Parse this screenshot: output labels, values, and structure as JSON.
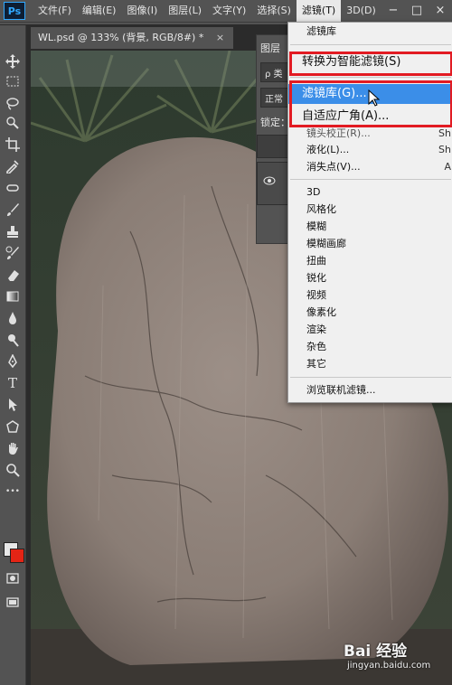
{
  "app": {
    "logo": "Ps",
    "menus": [
      "文件(F)",
      "编辑(E)",
      "图像(I)",
      "图层(L)",
      "文字(Y)",
      "选择(S)",
      "滤镜(T)",
      "3D(D)"
    ],
    "active_menu_index": 6,
    "window_controls": [
      "−",
      "□",
      "×"
    ]
  },
  "document_tab": {
    "title": "WL.psd @ 133% (背景, RGB/8#) *",
    "close": "×"
  },
  "toolbar": {
    "tools": [
      "move-icon",
      "marquee-icon",
      "lasso-icon",
      "quick-select-icon",
      "crop-icon",
      "eyedropper-icon",
      "healing-icon",
      "brush-icon",
      "stamp-icon",
      "history-brush-icon",
      "eraser-icon",
      "gradient-icon",
      "blur-icon",
      "dodge-icon",
      "pen-icon",
      "type-icon",
      "path-select-icon",
      "shape-icon",
      "hand-icon",
      "zoom-icon",
      "more-icon"
    ],
    "type_glyph": "T",
    "more_glyph": "•••",
    "colors": {
      "foreground": "#e8e8e8",
      "background": "#e32415"
    }
  },
  "layers_panel": {
    "title": "图层",
    "search_glyph": "ρ 类",
    "blend_mode": "正常",
    "lock_label": "锁定："
  },
  "filter_menu": {
    "items_top": [
      {
        "label": "滤镜库",
        "shortcut": ""
      }
    ],
    "smart_filter": "转换为智能滤镜(S)",
    "highlighted": "滤镜库(G)...",
    "adaptive": "自适应广角(A)...",
    "partial_items": [
      {
        "label": "镜头校正(R)...",
        "shortcut": "Sh"
      },
      {
        "label": "液化(L)...",
        "shortcut": "Sh"
      },
      {
        "label": "消失点(V)...",
        "shortcut": "A"
      }
    ],
    "submenus": [
      "3D",
      "风格化",
      "模糊",
      "模糊画廊",
      "扭曲",
      "锐化",
      "视频",
      "像素化",
      "渲染",
      "杂色",
      "其它"
    ],
    "browse": "浏览联机滤镜..."
  },
  "watermark": {
    "logo": "Bai 经验",
    "url": "jingyan.baidu.com"
  }
}
